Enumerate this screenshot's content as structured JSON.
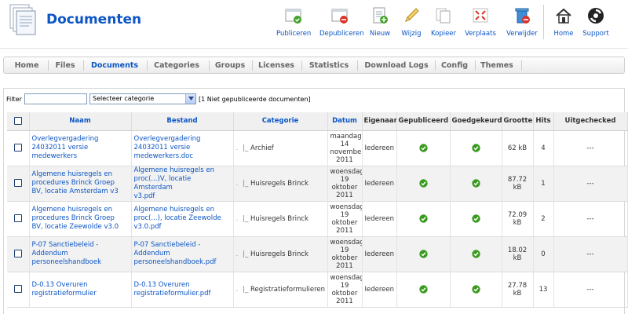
{
  "header": {
    "title": "Documenten",
    "toolbar": [
      {
        "label": "Publiceren",
        "icon": "publish-icon"
      },
      {
        "label": "Depubliceren",
        "icon": "unpublish-icon"
      },
      {
        "label": "Nieuw",
        "icon": "new-icon"
      },
      {
        "label": "Wijzig",
        "icon": "edit-icon"
      },
      {
        "label": "Kopieer",
        "icon": "copy-icon"
      },
      {
        "label": "Verplaats",
        "icon": "move-icon"
      },
      {
        "label": "Verwijder",
        "icon": "trash-icon"
      },
      {
        "label": "Home",
        "icon": "home-icon"
      },
      {
        "label": "Support",
        "icon": "support-icon"
      }
    ]
  },
  "tabs": [
    {
      "label": "Home",
      "active": false
    },
    {
      "label": "Files",
      "active": false
    },
    {
      "label": "Documents",
      "active": true
    },
    {
      "label": "Categories",
      "active": false
    },
    {
      "label": "Groups",
      "active": false
    },
    {
      "label": "Licenses",
      "active": false
    },
    {
      "label": "Statistics",
      "active": false
    },
    {
      "label": "Download Logs",
      "active": false
    },
    {
      "label": "Config",
      "active": false
    },
    {
      "label": "Themes",
      "active": false
    }
  ],
  "filter": {
    "label": "Filter",
    "value": "",
    "category_select": "Selecteer categorie",
    "unpublished_note": "[1 Niet gepubliceerde documenten]"
  },
  "table": {
    "columns": [
      "Naam",
      "Bestand",
      "Categorie",
      "Datum",
      "Eigenaar",
      "Gepubliceerd",
      "Goedgekeurd",
      "Grootte",
      "Hits",
      "Uitgechecked"
    ],
    "rows": [
      {
        "name": [
          "Overlegvergadering",
          "24032011 versie",
          "medewerkers"
        ],
        "file": [
          "Overlegvergadering",
          "24032011 versie",
          "medewerkers.doc"
        ],
        "category": "Archief",
        "date": [
          "maandag",
          "14",
          "november",
          "2011"
        ],
        "owner": "Iedereen",
        "published": true,
        "approved": true,
        "size": [
          "62 kB"
        ],
        "hits": "4",
        "checked_out": "---"
      },
      {
        "name": [
          "Algemene huisregels en",
          "procedures Brinck Groep",
          "BV, locatie Amsterdam v3"
        ],
        "file": [
          "Algemene huisregels en",
          "proc(...)V, locatie Amsterdam",
          "v3.pdf"
        ],
        "category": "Huisregels Brinck",
        "date": [
          "woensdag",
          "19 oktober",
          "2011"
        ],
        "owner": "Iedereen",
        "published": true,
        "approved": true,
        "size": [
          "87.72",
          "kB"
        ],
        "hits": "1",
        "checked_out": "---"
      },
      {
        "name": [
          "Algemene huisregels en",
          "procedures Brinck Groep",
          "BV, locatie Zeewolde v3.0"
        ],
        "file": [
          "Algemene huisregels en",
          "proc(...), locatie Zeewolde",
          "v3.0.pdf"
        ],
        "category": "Huisregels Brinck",
        "date": [
          "woensdag",
          "19 oktober",
          "2011"
        ],
        "owner": "Iedereen",
        "published": true,
        "approved": true,
        "size": [
          "72.09",
          "kB"
        ],
        "hits": "2",
        "checked_out": "---"
      },
      {
        "name": [
          "P-07 Sanctiebeleid -",
          "Addendum",
          "personeelshandboek"
        ],
        "file": [
          "P-07 Sanctiebeleid -",
          "Addendum",
          "personeelshandboek.pdf"
        ],
        "category": "Huisregels Brinck",
        "date": [
          "woensdag",
          "19 oktober",
          "2011"
        ],
        "owner": "Iedereen",
        "published": true,
        "approved": true,
        "size": [
          "18.02",
          "kB"
        ],
        "hits": "0",
        "checked_out": "---"
      },
      {
        "name": [
          "D-0.13 Overuren",
          "registratieformulier"
        ],
        "file": [
          "D-0.13 Overuren",
          "registratieformulier.pdf"
        ],
        "category": "Registratieformulieren",
        "date": [
          "woensdag",
          "19 oktober",
          "2011"
        ],
        "owner": "Iedereen",
        "published": true,
        "approved": true,
        "size": [
          "27.78",
          "kB"
        ],
        "hits": "13",
        "checked_out": "---"
      }
    ]
  },
  "colors": {
    "link": "#0b55c4",
    "check": "#3a9a1f",
    "header_bg": "#f0f0f0"
  }
}
